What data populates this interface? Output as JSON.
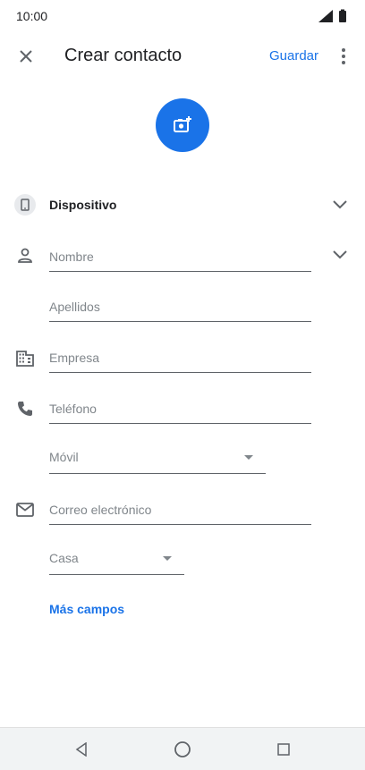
{
  "status_bar": {
    "time": "10:00"
  },
  "app_bar": {
    "title": "Crear contacto",
    "save_label": "Guardar"
  },
  "account": {
    "label": "Dispositivo"
  },
  "fields": {
    "first_name_placeholder": "Nombre",
    "last_name_placeholder": "Apellidos",
    "company_placeholder": "Empresa",
    "phone_placeholder": "Teléfono",
    "phone_type": "Móvil",
    "email_placeholder": "Correo electrónico",
    "email_type": "Casa"
  },
  "more_fields_label": "Más campos",
  "colors": {
    "accent": "#1a73e8",
    "icon": "#5f6368",
    "divider": "#5f6368"
  },
  "icons": [
    "close-icon",
    "more-vert-icon",
    "add-photo-icon",
    "phone-device-icon",
    "chevron-down-icon",
    "person-icon",
    "business-icon",
    "phone-icon",
    "email-icon",
    "dropdown-arrow-icon",
    "back-icon",
    "home-icon",
    "recents-icon",
    "signal-icon",
    "battery-icon"
  ]
}
